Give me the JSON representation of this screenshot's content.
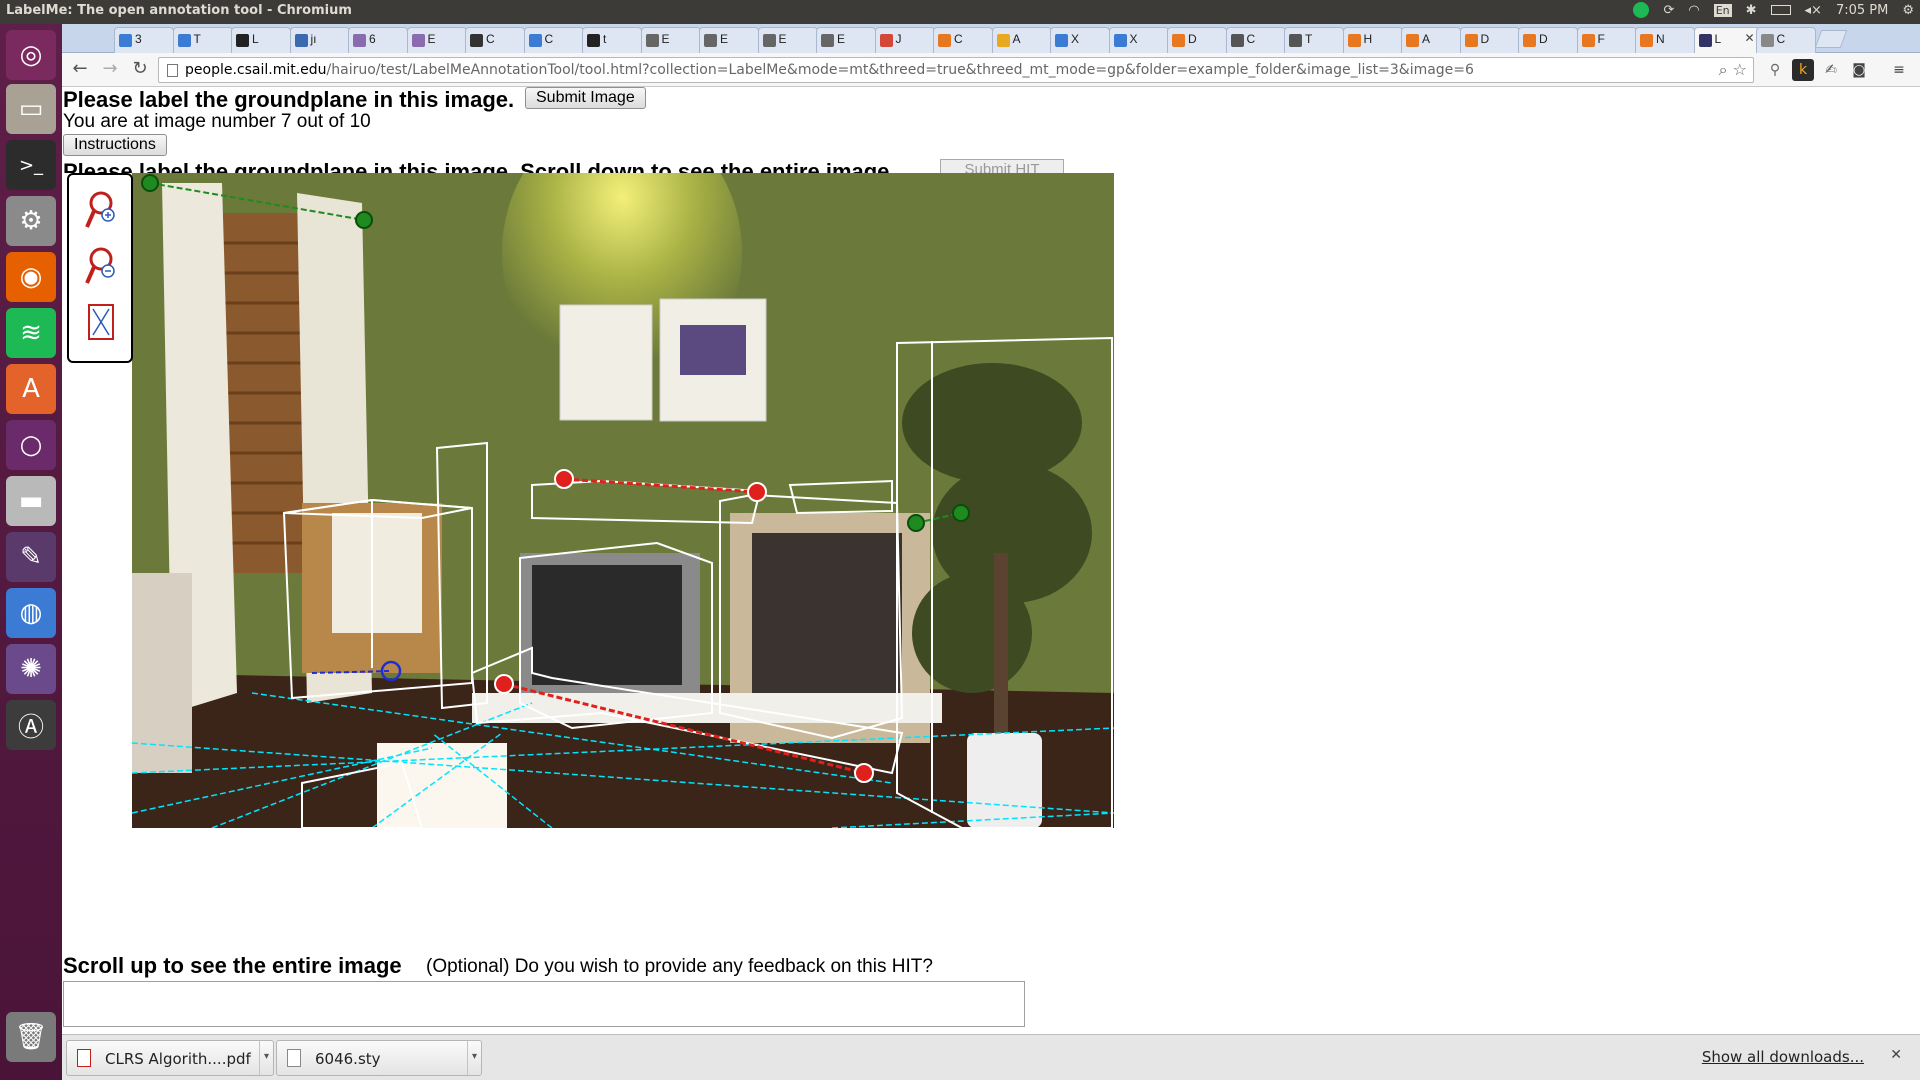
{
  "window": {
    "title": "LabelMe: The open annotation tool - Chromium",
    "time": "7:05 PM",
    "keyboard": "En"
  },
  "tabs": [
    {
      "label": "3",
      "color": "#3b7bd4"
    },
    {
      "label": "T",
      "color": "#3b7bd4"
    },
    {
      "label": "L",
      "color": "#222222"
    },
    {
      "label": "jı",
      "color": "#3a6ab0"
    },
    {
      "label": "6",
      "color": "#8a6bb0"
    },
    {
      "label": "E",
      "color": "#8a6bb0"
    },
    {
      "label": "C",
      "color": "#333333"
    },
    {
      "label": "C",
      "color": "#3b7bd4"
    },
    {
      "label": "t",
      "color": "#222222"
    },
    {
      "label": "E",
      "color": "#666666"
    },
    {
      "label": "E",
      "color": "#666666"
    },
    {
      "label": "E",
      "color": "#666666"
    },
    {
      "label": "E",
      "color": "#666666"
    },
    {
      "label": "J",
      "color": "#d44638"
    },
    {
      "label": "C",
      "color": "#e87722"
    },
    {
      "label": "A",
      "color": "#e8a820"
    },
    {
      "label": "X",
      "color": "#3b7bd4"
    },
    {
      "label": "X",
      "color": "#3b7bd4"
    },
    {
      "label": "D",
      "color": "#e87722"
    },
    {
      "label": "C",
      "color": "#555555"
    },
    {
      "label": "T",
      "color": "#555555"
    },
    {
      "label": "H",
      "color": "#e87722"
    },
    {
      "label": "A",
      "color": "#e87722"
    },
    {
      "label": "D",
      "color": "#e87722"
    },
    {
      "label": "D",
      "color": "#e87722"
    },
    {
      "label": "F",
      "color": "#e87722"
    },
    {
      "label": "N",
      "color": "#e87722"
    },
    {
      "label": "L",
      "color": "#333366",
      "active": true
    },
    {
      "label": "C",
      "color": "#888888"
    }
  ],
  "address": {
    "host": "people.csail.mit.edu",
    "path": "/hairuo/test/LabelMeAnnotationTool/tool.html?collection=LabelMe&mode=mt&threed=true&threed_mt_mode=gp&folder=example_folder&image_list=3&image=6"
  },
  "page": {
    "heading": "Please label the groundplane in this image.",
    "submit_image": "Submit Image",
    "status": "You are at image number 7 out of 10",
    "instructions": "Instructions",
    "hidden_heading": "Please label the groundplane in this image. Scroll down to see the entire image.",
    "submit_hit": "Submit HIT",
    "bottom_title": "Scroll up to see the entire image",
    "feedback_question": "(Optional) Do you wish to provide any feedback on this HIT?",
    "feedback_value": ""
  },
  "downloads": {
    "items": [
      {
        "name": "CLRS Algorith....pdf"
      },
      {
        "name": "6046.sty"
      }
    ],
    "show_all": "Show all downloads..."
  },
  "colors": {
    "launcher": "#5e1f48",
    "tabstrip": "#c7d6ea",
    "wall": "#6b7a3a",
    "floor": "#3b2418",
    "ground_line": "#00e5ff",
    "box": "#ffffff",
    "point_red": "#e0201c",
    "point_green": "#1f8a1f",
    "point_blue": "#1e2fd0"
  }
}
